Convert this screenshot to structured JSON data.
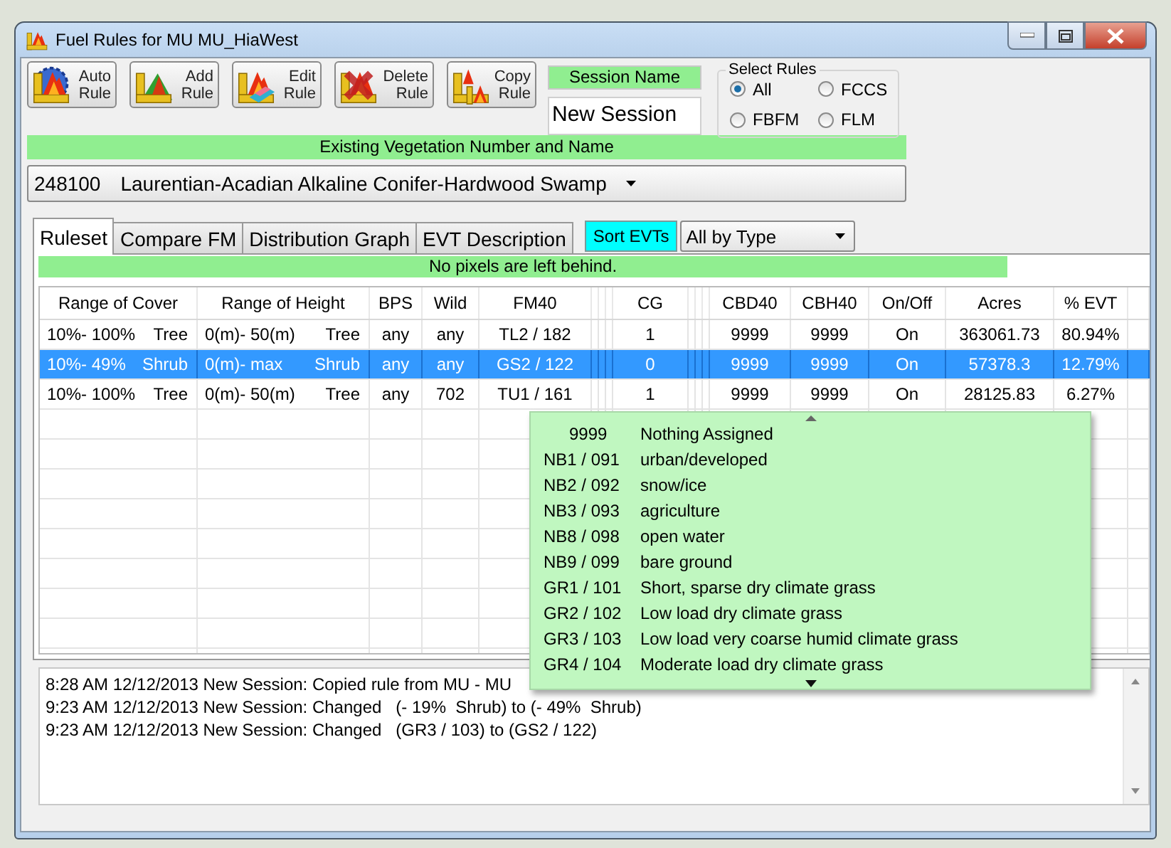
{
  "window": {
    "title": "Fuel Rules for MU MU_HiaWest"
  },
  "toolbar": [
    {
      "kind": "auto",
      "label": "Auto Rule"
    },
    {
      "kind": "add",
      "label": "Add Rule"
    },
    {
      "kind": "edit",
      "label": "Edit Rule"
    },
    {
      "kind": "delete",
      "label": "Delete Rule"
    },
    {
      "kind": "copy",
      "label": "Copy Rule"
    }
  ],
  "session": {
    "label": "Session Name",
    "value": "New Session"
  },
  "select_rules": {
    "title": "Select Rules",
    "options": [
      {
        "label": "All",
        "selected": true
      },
      {
        "label": "FCCS",
        "selected": false
      },
      {
        "label": "FBFM",
        "selected": false
      },
      {
        "label": "FLM",
        "selected": false
      }
    ]
  },
  "evt": {
    "label": "Existing Vegetation Number and Name",
    "number": "248100",
    "name": "Laurentian-Acadian Alkaline Conifer-Hardwood Swamp"
  },
  "tabs": [
    {
      "label": "Ruleset",
      "selected": true
    },
    {
      "label": "Compare FM",
      "selected": false
    },
    {
      "label": "Distribution Graph",
      "selected": false
    },
    {
      "label": "EVT Description",
      "selected": false
    }
  ],
  "sort_button": "Sort EVTs",
  "sort_select": {
    "value": "All by Type"
  },
  "status": "No pixels are left behind.",
  "table": {
    "columns": [
      "Range of Cover",
      "Range of Height",
      "BPS",
      "Wild",
      "FM40",
      "CG",
      "CBD40",
      "CBH40",
      "On/Off",
      "Acres",
      "% EVT"
    ],
    "rows": [
      {
        "cover_range": "10%- 100%",
        "cover_type": "Tree",
        "height_range": "0(m)- 50(m)",
        "height_type": "Tree",
        "bps": "any",
        "wild": "any",
        "fm40": "TL2 / 182",
        "cg": "1",
        "cbd40": "9999",
        "cbh40": "9999",
        "on_off": "On",
        "acres": "363061.73",
        "evt_pct": "80.94%",
        "selected": false
      },
      {
        "cover_range": "10%- 49%",
        "cover_type": "Shrub",
        "height_range": "0(m)- max",
        "height_type": "Shrub",
        "bps": "any",
        "wild": "any",
        "fm40": "GS2 / 122",
        "cg": "0",
        "cbd40": "9999",
        "cbh40": "9999",
        "on_off": "On",
        "acres": "57378.3",
        "evt_pct": "12.79%",
        "selected": true
      },
      {
        "cover_range": "10%- 100%",
        "cover_type": "Tree",
        "height_range": "0(m)- 50(m)",
        "height_type": "Tree",
        "bps": "any",
        "wild": "702",
        "fm40": "TU1 / 161",
        "cg": "1",
        "cbd40": "9999",
        "cbh40": "9999",
        "on_off": "On",
        "acres": "28125.83",
        "evt_pct": "6.27%",
        "selected": false
      }
    ]
  },
  "fm_dropdown": {
    "items": [
      {
        "code": "9999",
        "description": "Nothing Assigned"
      },
      {
        "code": "NB1 / 091",
        "description": "urban/developed"
      },
      {
        "code": "NB2 / 092",
        "description": "snow/ice"
      },
      {
        "code": "NB3 / 093",
        "description": "agriculture"
      },
      {
        "code": "NB8 / 098",
        "description": "open water"
      },
      {
        "code": "NB9 / 099",
        "description": "bare ground"
      },
      {
        "code": "GR1 / 101",
        "description": "Short, sparse dry climate grass"
      },
      {
        "code": "GR2 / 102",
        "description": "Low load dry climate grass"
      },
      {
        "code": "GR3 / 103",
        "description": "Low load very coarse humid climate grass"
      },
      {
        "code": "GR4 / 104",
        "description": "Moderate load dry climate grass"
      }
    ]
  },
  "log": [
    "8:28 AM 12/12/2013 New Session: Copied rule from MU - MU",
    "9:23 AM 12/12/2013 New Session: Changed   (- 19%  Shrub) to (- 49%  Shrub)",
    "9:23 AM 12/12/2013 New Session: Changed   (GR3 / 103) to (GS2 / 122)"
  ]
}
